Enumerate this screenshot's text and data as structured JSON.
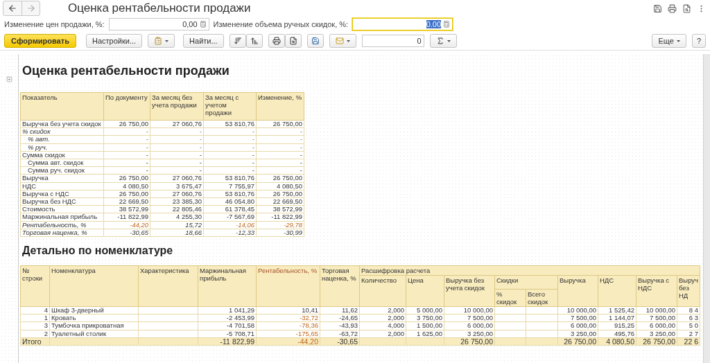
{
  "window": {
    "title": "Оценка рентабельности продажи"
  },
  "params": [
    {
      "label": "Изменение цен продажи, %:",
      "value": "0,00",
      "focused": false
    },
    {
      "label": "Изменение объема ручных скидок, %:",
      "value": "0.00",
      "focused": true
    }
  ],
  "toolbar": {
    "generate": "Сформировать",
    "settings": "Настройки...",
    "find": "Найти...",
    "counter": "0",
    "more": "Еще",
    "help": "?"
  },
  "report": {
    "title": "Оценка рентабельности продажи",
    "summary_table": {
      "columns": [
        "Показатель",
        "По документу",
        "За месяц без учета продажи",
        "За месяц с учетом продажи",
        "Изменение, %"
      ],
      "rows": [
        {
          "italic": false,
          "cells": [
            "Выручка без учета скидок",
            "26 750,00",
            "27 060,76",
            "53 810,76",
            "26 750,00"
          ],
          "alert": [
            false,
            false,
            false,
            false,
            false
          ]
        },
        {
          "italic": true,
          "cells": [
            "% скидок",
            "-",
            "-",
            "-",
            "-"
          ],
          "alert": [
            false,
            false,
            false,
            false,
            false
          ],
          "children": [
            {
              "italic": true,
              "cells": [
                "% авт.",
                "-",
                "-",
                "-",
                "-"
              ],
              "alert": [
                false,
                false,
                false,
                false,
                false
              ]
            },
            {
              "italic": true,
              "cells": [
                "% руч.",
                "-",
                "-",
                "-",
                "-"
              ],
              "alert": [
                false,
                false,
                false,
                false,
                false
              ]
            }
          ]
        },
        {
          "italic": false,
          "cells": [
            "Сумма скидок",
            "-",
            "-",
            "-",
            "-"
          ],
          "alert": [
            false,
            false,
            false,
            false,
            false
          ],
          "children": [
            {
              "italic": false,
              "cells": [
                "Сумма авт. скидок",
                "-",
                "-",
                "-",
                "-"
              ],
              "alert": [
                false,
                false,
                false,
                false,
                false
              ]
            },
            {
              "italic": false,
              "cells": [
                "Сумма руч. скидок",
                "-",
                "-",
                "-",
                "-"
              ],
              "alert": [
                false,
                false,
                false,
                false,
                false
              ]
            }
          ]
        },
        {
          "italic": false,
          "cells": [
            "Выручка",
            "26 750,00",
            "27 060,76",
            "53 810,76",
            "26 750,00"
          ],
          "alert": [
            false,
            false,
            false,
            false,
            false
          ]
        },
        {
          "italic": false,
          "cells": [
            "НДС",
            "4 080,50",
            "3 675,47",
            "7 755,97",
            "4 080,50"
          ],
          "alert": [
            false,
            false,
            false,
            false,
            false
          ]
        },
        {
          "italic": false,
          "cells": [
            "Выручка с НДС",
            "26 750,00",
            "27 060,76",
            "53 810,76",
            "26 750,00"
          ],
          "alert": [
            false,
            false,
            false,
            false,
            false
          ]
        },
        {
          "italic": false,
          "cells": [
            "Выручка без НДС",
            "22 669,50",
            "23 385,30",
            "46 054,80",
            "22 669,50"
          ],
          "alert": [
            false,
            false,
            false,
            false,
            false
          ]
        },
        {
          "italic": false,
          "cells": [
            "Стоимость",
            "38 572,99",
            "22 805,46",
            "61 378,45",
            "38 572,99"
          ],
          "alert": [
            false,
            false,
            false,
            false,
            false
          ]
        },
        {
          "italic": false,
          "cells": [
            "Маржинальная прибыль",
            "-11 822,99",
            "4 255,30",
            "-7 567,69",
            "-11 822,99"
          ],
          "alert": [
            false,
            false,
            false,
            false,
            false
          ]
        },
        {
          "italic": true,
          "cells": [
            "Рентабельность, %",
            "-44,20",
            "15,72",
            "-14,06",
            "-29,78"
          ],
          "alert": [
            false,
            true,
            false,
            true,
            true
          ]
        },
        {
          "italic": true,
          "cells": [
            "Торговая наценка, %",
            "-30,65",
            "18,66",
            "-12,33",
            "-30,99"
          ],
          "alert": [
            false,
            false,
            false,
            false,
            false
          ]
        }
      ]
    },
    "detail_title": "Детально по номенклатуре",
    "detail_table": {
      "header": [
        {
          "label": "№ строки",
          "alert": false
        },
        {
          "label": "Номенклатура",
          "alert": false
        },
        {
          "label": "Характеристика",
          "alert": false
        },
        {
          "label": "Маржинальная прибыль",
          "alert": false
        },
        {
          "label": "Рентабельность, %",
          "alert": true
        },
        {
          "label": "Торговая наценка, %",
          "alert": false
        },
        {
          "label": "Расшифровка расчета",
          "alert": false,
          "children": [
            {
              "label": "Количество",
              "alert": false
            },
            {
              "label": "Цена",
              "alert": false
            },
            {
              "label": "Выручка без учета скидок",
              "alert": false
            },
            {
              "label": "Скидки",
              "alert": false,
              "children": [
                {
                  "label": "% скидок",
                  "alert": false
                },
                {
                  "label": "Всего скидок",
                  "alert": false
                }
              ]
            },
            {
              "label": "Выручка",
              "alert": false
            },
            {
              "label": "НДС",
              "alert": false
            },
            {
              "label": "Выручка с НДС",
              "alert": false
            },
            {
              "label": "Выруч без НД",
              "alert": false
            }
          ]
        }
      ],
      "rows": [
        {
          "cells": [
            "4",
            "Шкаф 3-дверный",
            null,
            "1 041,29",
            "10,41",
            "11,62",
            "2,000",
            "5 000,00",
            "10 000,00",
            null,
            null,
            "10 000,00",
            "1 525,42",
            "10 000,00",
            "8 4"
          ],
          "rent_alert": false
        },
        {
          "cells": [
            "1",
            "Кровать",
            null,
            "-2 453,99",
            "-32,72",
            "-24,65",
            "2,000",
            "3 750,00",
            "7 500,00",
            null,
            null,
            "7 500,00",
            "1 144,07",
            "7 500,00",
            "6 3"
          ],
          "rent_alert": true
        },
        {
          "cells": [
            "3",
            "Тумбочка прикроватная",
            null,
            "-4 701,58",
            "-78,36",
            "-43,93",
            "4,000",
            "1 500,00",
            "6 000,00",
            null,
            null,
            "6 000,00",
            "915,25",
            "6 000,00",
            "5 0"
          ],
          "rent_alert": true
        },
        {
          "cells": [
            "2",
            "Туалетный столик",
            null,
            "-5 708,71",
            "-175,65",
            "-63,72",
            "2,000",
            "1 625,00",
            "3 250,00",
            null,
            null,
            "3 250,00",
            "495,76",
            "3 250,00",
            "2 7"
          ],
          "rent_alert": true
        }
      ],
      "total": {
        "cells": [
          "Итого",
          null,
          null,
          "-11 822,99",
          "-44,20",
          "-30,65",
          null,
          null,
          "26 750,00",
          null,
          null,
          "26 750,00",
          "4 080,50",
          "26 750,00",
          "22 6"
        ],
        "rent_alert": true
      }
    }
  }
}
